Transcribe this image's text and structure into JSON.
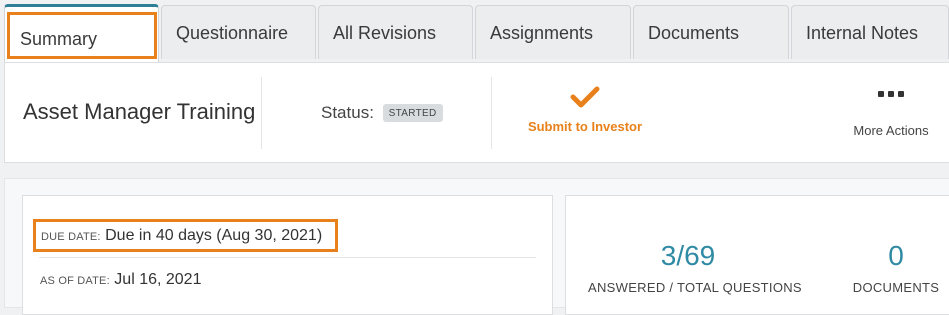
{
  "tabs": [
    {
      "label": "Summary",
      "active": true
    },
    {
      "label": "Questionnaire"
    },
    {
      "label": "All Revisions"
    },
    {
      "label": "Assignments"
    },
    {
      "label": "Documents"
    },
    {
      "label": "Internal Notes"
    }
  ],
  "header": {
    "title": "Asset Manager Training",
    "status_label": "Status:",
    "status_badge": "STARTED",
    "submit": {
      "label": "Submit to Investor",
      "icon": "check-icon"
    },
    "more": {
      "label": "More Actions",
      "icon": "ellipsis-icon"
    }
  },
  "details": {
    "due_label": "DUE DATE:",
    "due_value": "Due in 40 days (Aug 30, 2021)",
    "asof_label": "AS OF DATE:",
    "asof_value": "Jul 16, 2021"
  },
  "stats": [
    {
      "value": "3/69",
      "caption": "ANSWERED / TOTAL QUESTIONS"
    },
    {
      "value": "0",
      "caption": "DOCUMENTS"
    }
  ],
  "colors": {
    "accent": "#e8811c",
    "teal": "#2f8aa3",
    "tab_top": "#2f7f97"
  }
}
